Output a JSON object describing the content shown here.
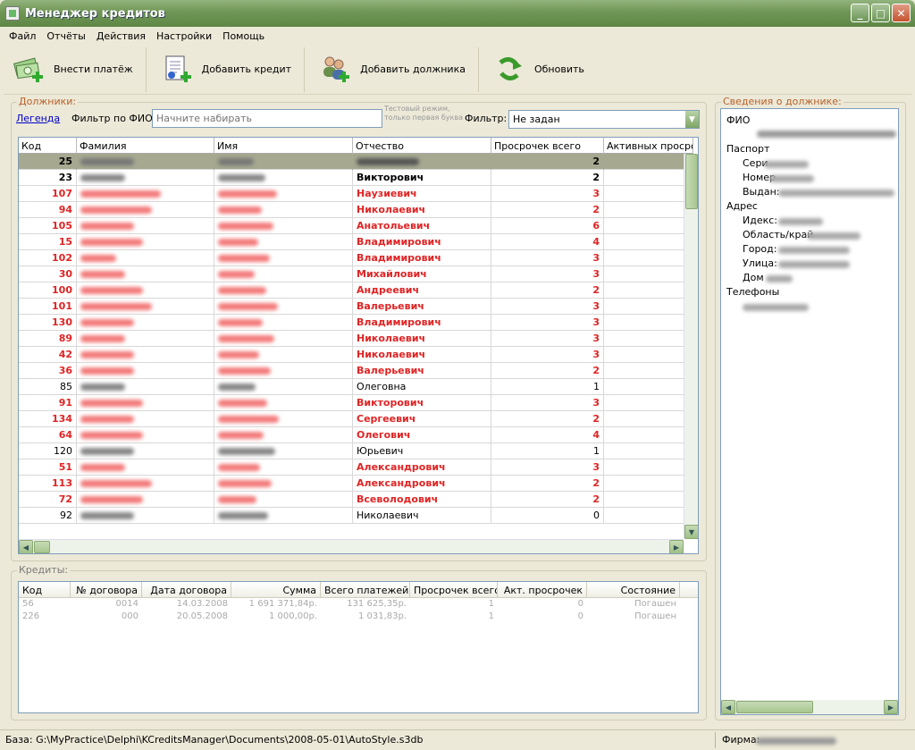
{
  "window": {
    "title": "Менеджер кредитов"
  },
  "menu": [
    "Файл",
    "Отчёты",
    "Действия",
    "Настройки",
    "Помощь"
  ],
  "toolbar": {
    "pay": "Внести платёж",
    "add_credit": "Добавить кредит",
    "add_debtor": "Добавить должника",
    "refresh": "Обновить"
  },
  "debtors": {
    "group_title": "Должники:",
    "legend_link": "Легенда",
    "filter_label": "Фильтр по ФИО:",
    "filter_placeholder": "Начните набирать",
    "test_note": "Тестовый режим, только первая буква",
    "filter2_label": "Фильтр:",
    "filter2_value": "Не задан",
    "columns": [
      "Код",
      "Фамилия",
      "Имя",
      "Отчество",
      "Просрочек всего",
      "Активных просрочек"
    ],
    "rows": [
      {
        "code": "25",
        "patronymic": "",
        "overdue": "2",
        "style": "selected"
      },
      {
        "code": "23",
        "patronymic": "Викторович",
        "overdue": "2",
        "style": "bold"
      },
      {
        "code": "107",
        "patronymic": "Наузиевич",
        "overdue": "3",
        "style": "red"
      },
      {
        "code": "94",
        "patronymic": "Николаевич",
        "overdue": "2",
        "style": "red"
      },
      {
        "code": "105",
        "patronymic": "Анатольевич",
        "overdue": "6",
        "style": "red"
      },
      {
        "code": "15",
        "patronymic": "Владимирович",
        "overdue": "4",
        "style": "red"
      },
      {
        "code": "102",
        "patronymic": "Владимирович",
        "overdue": "3",
        "style": "red"
      },
      {
        "code": "30",
        "patronymic": "Михайлович",
        "overdue": "3",
        "style": "red"
      },
      {
        "code": "100",
        "patronymic": "Андреевич",
        "overdue": "2",
        "style": "red"
      },
      {
        "code": "101",
        "patronymic": "Валерьевич",
        "overdue": "3",
        "style": "red"
      },
      {
        "code": "130",
        "patronymic": "Владимирович",
        "overdue": "3",
        "style": "red"
      },
      {
        "code": "89",
        "patronymic": "Николаевич",
        "overdue": "3",
        "style": "red"
      },
      {
        "code": "42",
        "patronymic": "Николаевич",
        "overdue": "3",
        "style": "red"
      },
      {
        "code": "36",
        "patronymic": "Валерьевич",
        "overdue": "2",
        "style": "red"
      },
      {
        "code": "85",
        "patronymic": "Олеговна",
        "overdue": "1",
        "style": "normal"
      },
      {
        "code": "91",
        "patronymic": "Викторович",
        "overdue": "3",
        "style": "red"
      },
      {
        "code": "134",
        "patronymic": "Сергеевич",
        "overdue": "2",
        "style": "red"
      },
      {
        "code": "64",
        "patronymic": "Олегович",
        "overdue": "4",
        "style": "red"
      },
      {
        "code": "120",
        "patronymic": "Юрьевич",
        "overdue": "1",
        "style": "normal"
      },
      {
        "code": "51",
        "patronymic": "Александрович",
        "overdue": "3",
        "style": "red"
      },
      {
        "code": "113",
        "patronymic": "Александрович",
        "overdue": "2",
        "style": "red"
      },
      {
        "code": "72",
        "patronymic": "Всеволодович",
        "overdue": "2",
        "style": "red"
      },
      {
        "code": "92",
        "patronymic": "Николаевич",
        "overdue": "0",
        "style": "normal"
      }
    ]
  },
  "credits": {
    "group_title": "Кредиты:",
    "columns": [
      "Код",
      "№ договора",
      "Дата договора",
      "Сумма",
      "Всего платежей",
      "Просрочек всего",
      "Акт. просрочек",
      "Состояние"
    ],
    "rows": [
      [
        "56",
        "0014",
        "14.03.2008",
        "1 691 371,84р.",
        "131 625,35р.",
        "1",
        "0",
        "Погашен"
      ],
      [
        "226",
        "000",
        "20.05.2008",
        "1 000,00р.",
        "1 031,83р.",
        "1",
        "0",
        "Погашен"
      ]
    ]
  },
  "info": {
    "group_title": "Сведения о должнике:",
    "fio": "ФИО",
    "passport": "Паспорт",
    "series": "Сери",
    "number": "Номер",
    "issued": "Выдан:",
    "address": "Адрес",
    "index": "Идекс:",
    "region": "Область/край",
    "city": "Город:",
    "street": "Улица:",
    "house": "Дом",
    "phones": "Телефоны"
  },
  "status": {
    "db": "База: G:\\MyPractice\\Delphi\\KCreditsManager\\Documents\\2008-05-01\\AutoStyle.s3db",
    "firm": "Фирма:"
  },
  "colors": {
    "overdue_red": "#e02424",
    "selected_row": "#a6a990",
    "title_green": "#6f9654"
  }
}
